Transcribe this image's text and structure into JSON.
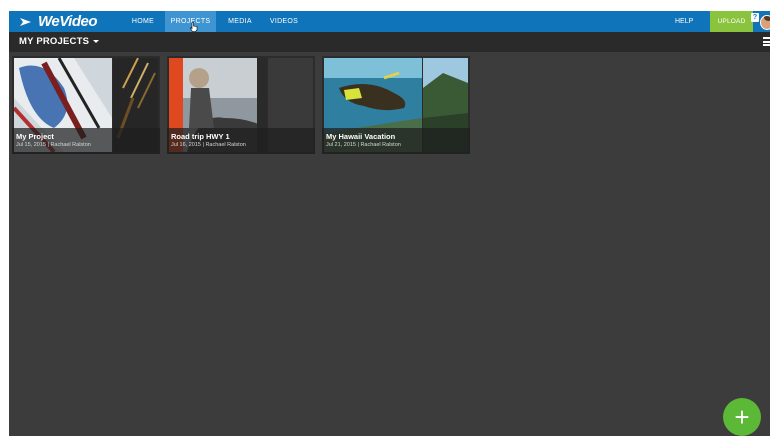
{
  "app": {
    "logo_text": "WeVideo"
  },
  "topnav": {
    "items": [
      {
        "label": "HOME"
      },
      {
        "label": "PROJECTS"
      },
      {
        "label": "MEDIA"
      },
      {
        "label": "VIDEOS"
      }
    ],
    "active": "PROJECTS",
    "help_label": "HELP",
    "upload_label": "UPLOAD",
    "help_badge": "?"
  },
  "subheader": {
    "title": "MY PROJECTS"
  },
  "projects": [
    {
      "title": "My Project",
      "meta": "Jul 15, 2015 | Rachael Ralston"
    },
    {
      "title": "Road trip HWY 1",
      "meta": "Jul 16, 2015 | Rachael Ralston"
    },
    {
      "title": "My Hawaii Vacation",
      "meta": "Jul 21, 2015 | Rachael Ralston"
    }
  ],
  "fab": {
    "label": "+"
  },
  "colors": {
    "topbar": "#0f74b9",
    "active_tab": "#3f95d1",
    "upload": "#8ac43f",
    "fab": "#5cb837",
    "background": "#3c3c3c",
    "subbar": "#2a2a2a"
  }
}
